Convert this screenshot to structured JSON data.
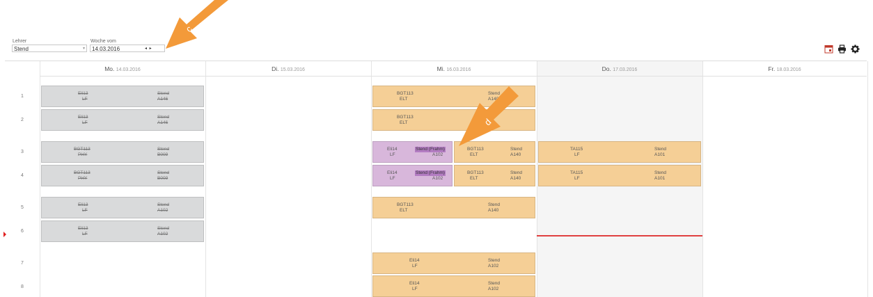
{
  "filters": {
    "teacher_label": "Lehrer",
    "teacher_value": "Stend",
    "week_label": "Woche vom",
    "week_value": "14.03.2016",
    "week_nav": "◂ ▸"
  },
  "annotations": {
    "c": "c",
    "d": "d"
  },
  "days": [
    {
      "name": "Mo.",
      "date": "14.03.2016"
    },
    {
      "name": "Di.",
      "date": "15.03.2016"
    },
    {
      "name": "Mi.",
      "date": "16.03.2016"
    },
    {
      "name": "Do.",
      "date": "17.03.2016"
    },
    {
      "name": "Fr.",
      "date": "18.03.2016"
    }
  ],
  "periods": [
    "1",
    "2",
    "3",
    "4",
    "5",
    "6",
    "7",
    "8"
  ],
  "lessons": {
    "mo": [
      {
        "class": "Eli13",
        "subject": "LF",
        "teacher": "Stend",
        "room": "A146"
      },
      {
        "class": "Eli13",
        "subject": "LF",
        "teacher": "Stend",
        "room": "A146"
      },
      {
        "class": "BGT113",
        "subject": "PHY",
        "teacher": "Stend",
        "room": "B009"
      },
      {
        "class": "BGT113",
        "subject": "PHY",
        "teacher": "Stend",
        "room": "B009"
      },
      {
        "class": "Eli13",
        "subject": "LF",
        "teacher": "Stend",
        "room": "A102"
      },
      {
        "class": "Eli13",
        "subject": "LF",
        "teacher": "Stend",
        "room": "A102"
      }
    ],
    "mi": [
      {
        "class": "BGT113",
        "subject": "ELT",
        "teacher": "Stend",
        "room": "A140"
      },
      {
        "class": "BGT113",
        "subject": "ELT",
        "teacher": "",
        "room": ""
      },
      {
        "class": "Eli14",
        "subject": "LF",
        "teacher": "Stend (Frahm)",
        "room": "A102"
      },
      {
        "class": "BGT113",
        "subject": "ELT",
        "teacher": "Stend",
        "room": "A140"
      },
      {
        "class": "Eli14",
        "subject": "LF",
        "teacher": "Stend (Frahm)",
        "room": "A102"
      },
      {
        "class": "BGT113",
        "subject": "ELT",
        "teacher": "Stend",
        "room": "A140"
      },
      {
        "class": "BGT113",
        "subject": "ELT",
        "teacher": "Stend",
        "room": "A140"
      },
      {
        "class": "Eli14",
        "subject": "LF",
        "teacher": "Stend",
        "room": "A102"
      },
      {
        "class": "Eli14",
        "subject": "LF",
        "teacher": "Stend",
        "room": "A102"
      }
    ],
    "do": [
      {
        "class": "TA115",
        "subject": "LF",
        "teacher": "Stend",
        "room": "A101"
      },
      {
        "class": "TA115",
        "subject": "LF",
        "teacher": "Stend",
        "room": "A101"
      }
    ]
  },
  "colors": {
    "cancelled": "#d9dadb",
    "lesson": "#f5cf96",
    "substitution": "#d8b7db",
    "current_time": "#e04040"
  }
}
